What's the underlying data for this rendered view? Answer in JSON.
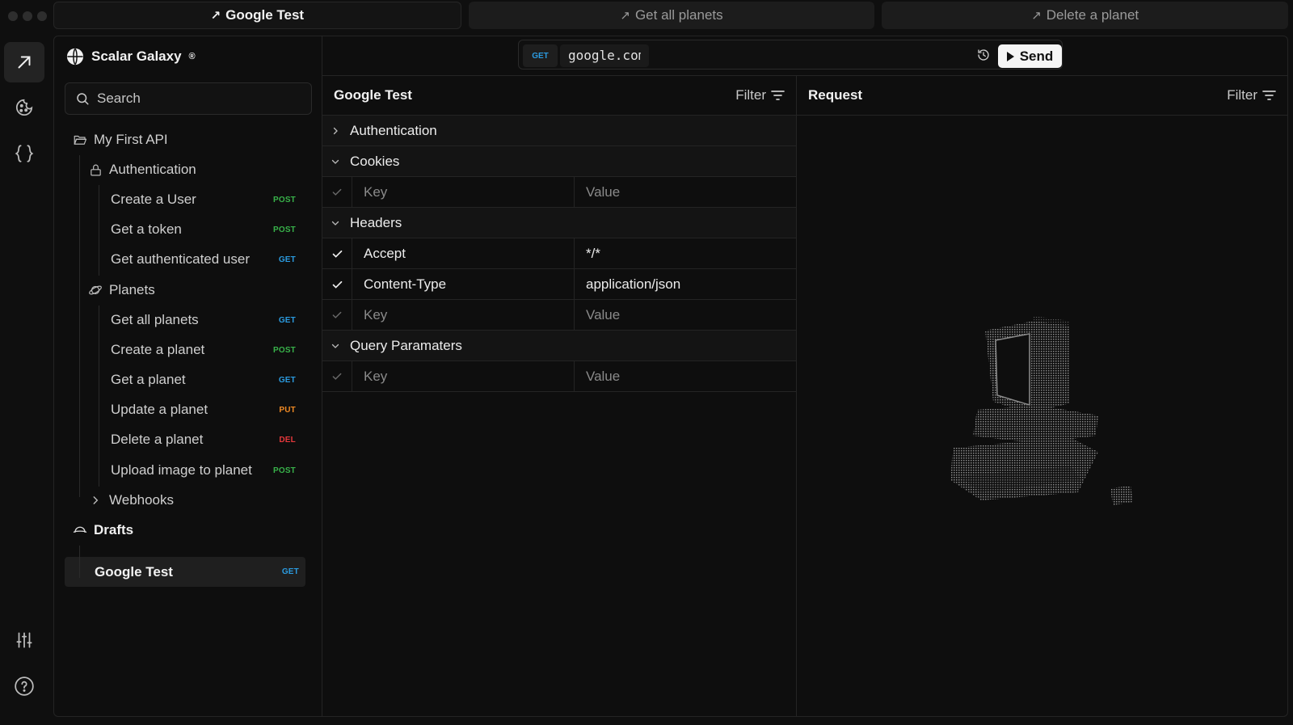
{
  "tabs": [
    {
      "label": "Google Test",
      "active": true
    },
    {
      "label": "Get all planets",
      "active": false
    },
    {
      "label": "Delete a planet",
      "active": false
    }
  ],
  "rail": {
    "icons": [
      "request-arrow-icon",
      "cookie-icon",
      "braces-icon",
      "sliders-icon",
      "help-icon"
    ]
  },
  "sidebar": {
    "brand": "Scalar Galaxy",
    "brand_mark": "®",
    "search_placeholder": "Search",
    "collection": "My First API",
    "folders": {
      "auth": "Authentication",
      "planets": "Planets",
      "webhooks": "Webhooks"
    },
    "auth_items": [
      {
        "label": "Create a User",
        "method": "POST"
      },
      {
        "label": "Get a token",
        "method": "POST"
      },
      {
        "label": "Get authenticated user",
        "method": "GET"
      }
    ],
    "planet_items": [
      {
        "label": "Get all planets",
        "method": "GET"
      },
      {
        "label": "Create a planet",
        "method": "POST"
      },
      {
        "label": "Get a planet",
        "method": "GET"
      },
      {
        "label": "Update a planet",
        "method": "PUT"
      },
      {
        "label": "Delete a planet",
        "method": "DEL"
      },
      {
        "label": "Upload image to planet",
        "method": "POST"
      }
    ],
    "drafts": "Drafts",
    "draft_items": [
      {
        "label": "Google Test",
        "method": "GET"
      }
    ]
  },
  "urlbar": {
    "method": "GET",
    "url": "google.com",
    "send_label": "Send"
  },
  "request": {
    "title": "Google Test",
    "filter_label": "Filter",
    "sections": {
      "auth": "Authentication",
      "cookies": "Cookies",
      "headers": "Headers",
      "query": "Query Paramaters"
    },
    "placeholders": {
      "key": "Key",
      "value": "Value"
    },
    "headers": [
      {
        "key": "Accept",
        "value": "*/*"
      },
      {
        "key": "Content-Type",
        "value": "application/json"
      }
    ]
  },
  "response": {
    "title": "Request",
    "filter_label": "Filter"
  },
  "colors": {
    "post": "#38b24a",
    "get": "#2b9be0",
    "put": "#f08a24",
    "del": "#e5383b"
  }
}
